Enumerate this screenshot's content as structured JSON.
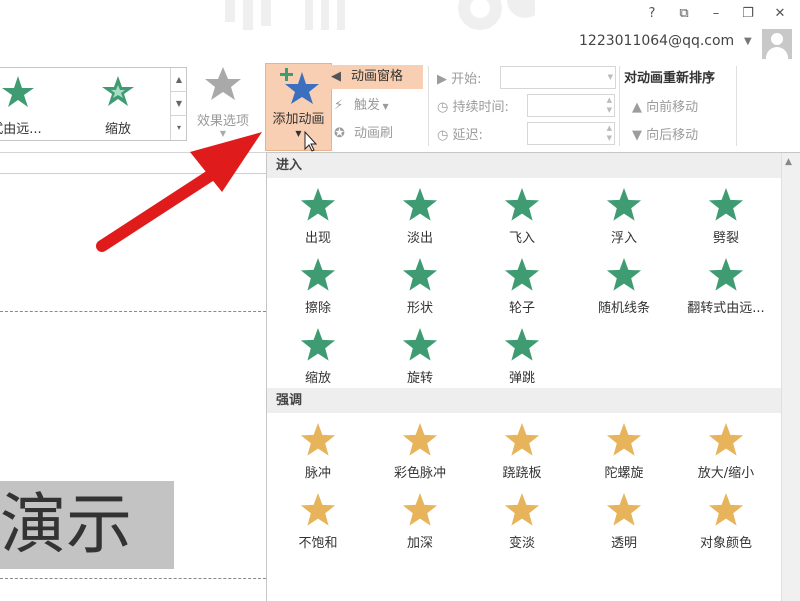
{
  "titlebar": {
    "help_label": "?",
    "restore_ribbon_label": "⧉",
    "minimize_label": "–",
    "maximize_label": "❐",
    "close_label": "✕",
    "account": "1223011064@qq.com"
  },
  "ribbon": {
    "gallery_items": [
      {
        "label": "式由远..."
      },
      {
        "label": "缩放"
      }
    ],
    "effect_options_label": "效果选项",
    "add_animation_label": "添加动画",
    "animation_pane_label": "动画窗格",
    "trigger_label": "触发",
    "animation_painter_label": "动画刷",
    "timing": {
      "start_label": "开始:",
      "duration_label": "持续时间:",
      "delay_label": "延迟:"
    },
    "reorder": {
      "title": "对动画重新排序",
      "move_earlier_label": "向前移动",
      "move_later_label": "向后移动"
    }
  },
  "slide": {
    "text": "演示"
  },
  "dropdown": {
    "sections": [
      {
        "title": "进入",
        "items": [
          {
            "label": "出现",
            "icon": "appear-star-icon"
          },
          {
            "label": "淡出",
            "icon": "fade-star-icon"
          },
          {
            "label": "飞入",
            "icon": "fly-in-star-icon"
          },
          {
            "label": "浮入",
            "icon": "float-in-star-icon"
          },
          {
            "label": "劈裂",
            "icon": "split-star-icon"
          },
          {
            "label": "擦除",
            "icon": "wipe-star-icon"
          },
          {
            "label": "形状",
            "icon": "shape-star-icon"
          },
          {
            "label": "轮子",
            "icon": "wheel-star-icon"
          },
          {
            "label": "随机线条",
            "icon": "random-bars-star-icon"
          },
          {
            "label": "翻转式由远...",
            "icon": "grow-turn-star-icon"
          },
          {
            "label": "缩放",
            "icon": "zoom-star-icon"
          },
          {
            "label": "旋转",
            "icon": "swivel-star-icon"
          },
          {
            "label": "弹跳",
            "icon": "bounce-star-icon"
          }
        ]
      },
      {
        "title": "强调",
        "items": [
          {
            "label": "脉冲",
            "icon": "pulse-star-icon"
          },
          {
            "label": "彩色脉冲",
            "icon": "color-pulse-star-icon"
          },
          {
            "label": "跷跷板",
            "icon": "teeter-star-icon"
          },
          {
            "label": "陀螺旋",
            "icon": "spin-star-icon"
          },
          {
            "label": "放大/缩小",
            "icon": "grow-shrink-star-icon"
          },
          {
            "label": "不饱和",
            "icon": "desaturate-star-icon"
          },
          {
            "label": "加深",
            "icon": "darken-star-icon"
          },
          {
            "label": "变淡",
            "icon": "lighten-star-icon"
          },
          {
            "label": "透明",
            "icon": "transparency-star-icon"
          },
          {
            "label": "对象颜色",
            "icon": "object-color-star-icon"
          }
        ]
      }
    ]
  },
  "colors": {
    "entrance_green": "#3f9c72",
    "emphasis_gold": "#e7b45c",
    "selected_bg": "#f8cfb2",
    "arrow_red": "#e01b1b",
    "star_blue": "#3d6fbf"
  }
}
